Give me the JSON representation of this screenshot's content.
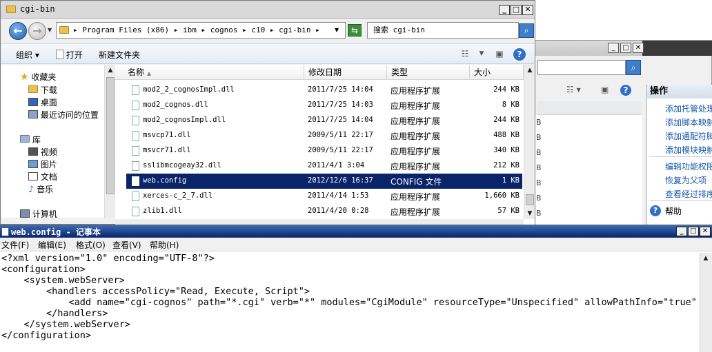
{
  "background_window": {
    "actions_header": "操作",
    "actions": [
      "添加托管处理",
      "添加脚本映射",
      "添加通配符脚",
      "添加模块映射",
      "编辑功能权限",
      "恢复为父项",
      "查看经过排序"
    ],
    "help": "帮助",
    "list_suffix": "B"
  },
  "explorer": {
    "title": "cgi-bin",
    "address_path": [
      "Program Files (x86)",
      "ibm",
      "cognos",
      "c10",
      "cgi-bin"
    ],
    "search_placeholder": "搜索 cgi-bin",
    "toolbar": {
      "organize": "组织",
      "open": "打开",
      "new_folder": "新建文件夹"
    },
    "nav": {
      "favorites": "收藏夹",
      "downloads": "下载",
      "desktop": "桌面",
      "recent": "最近访问的位置",
      "libraries": "库",
      "videos": "视频",
      "pictures": "图片",
      "documents": "文档",
      "music": "音乐",
      "computer": "计算机"
    },
    "columns": {
      "name": "名称",
      "date": "修改日期",
      "type": "类型",
      "size": "大小"
    },
    "files": [
      {
        "name": "mod2_2_cognosImpl.dll",
        "date": "2011/7/25 14:04",
        "type": "应用程序扩展",
        "size": "244 KB",
        "selected": false
      },
      {
        "name": "mod2_cognos.dll",
        "date": "2011/7/25 14:03",
        "type": "应用程序扩展",
        "size": "8 KB",
        "selected": false
      },
      {
        "name": "mod2_cognosImpl.dll",
        "date": "2011/7/25 14:04",
        "type": "应用程序扩展",
        "size": "244 KB",
        "selected": false
      },
      {
        "name": "msvcp71.dll",
        "date": "2009/5/11 22:17",
        "type": "应用程序扩展",
        "size": "488 KB",
        "selected": false
      },
      {
        "name": "msvcr71.dll",
        "date": "2009/5/11 22:17",
        "type": "应用程序扩展",
        "size": "340 KB",
        "selected": false
      },
      {
        "name": "sslibmcogeay32.dll",
        "date": "2011/4/1 3:04",
        "type": "应用程序扩展",
        "size": "212 KB",
        "selected": false
      },
      {
        "name": "web.config",
        "date": "2012/12/6 16:37",
        "type": "CONFIG 文件",
        "size": "1 KB",
        "selected": true
      },
      {
        "name": "xerces-c_2_7.dll",
        "date": "2011/4/14 1:53",
        "type": "应用程序扩展",
        "size": "1,660 KB",
        "selected": false
      },
      {
        "name": "zlib1.dll",
        "date": "2011/4/20 0:28",
        "type": "应用程序扩展",
        "size": "57 KB",
        "selected": false
      }
    ]
  },
  "notepad": {
    "title": "web.config - 记事本",
    "menu": [
      "文件(F)",
      "编辑(E)",
      "格式(O)",
      "查看(V)",
      "帮助(H)"
    ],
    "lines": [
      "<?xml version=\"1.0\" encoding=\"UTF-8\"?>",
      "<configuration>",
      "    <system.webServer>",
      "        <handlers accessPolicy=\"Read, Execute, Script\">",
      "            <add name=\"cgi-cognos\" path=\"*.cgi\" verb=\"*\" modules=\"CgiModule\" resourceType=\"Unspecified\" allowPathInfo=\"true\" />",
      "        </handlers>",
      "    </system.webServer>",
      "</configuration>"
    ]
  },
  "colors": {
    "selection": "#0a246a",
    "link": "#1a56a8",
    "accent": "#2f6fc7"
  }
}
